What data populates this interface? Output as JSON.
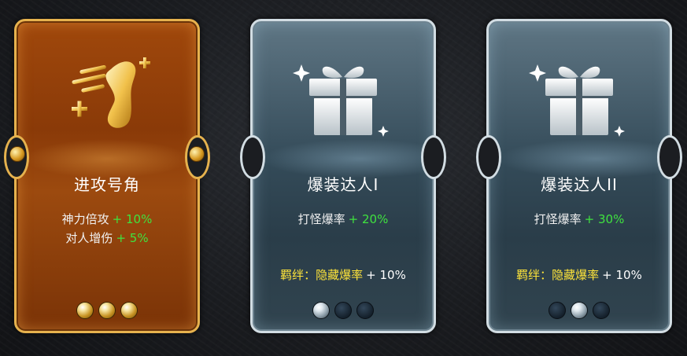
{
  "cards": [
    {
      "title": "进攻号角",
      "icon": "golden-foot-icon",
      "stats": [
        {
          "name": "神力倍攻",
          "value": "+ 10%"
        },
        {
          "name": "对人增伤",
          "value": "+ 5%"
        }
      ],
      "gems_active": 3,
      "gems_total": 3
    },
    {
      "title": "爆装达人I",
      "icon": "silver-gift-icon",
      "stats": [
        {
          "name": "打怪爆率",
          "value": "+ 20%"
        }
      ],
      "bond": {
        "label": "羁绊：隐藏爆率",
        "value": "+ 10%"
      },
      "gems_active": 1,
      "gems_total": 3
    },
    {
      "title": "爆装达人II",
      "icon": "silver-gift-icon",
      "stats": [
        {
          "name": "打怪爆率",
          "value": "+ 30%"
        }
      ],
      "bond": {
        "label": "羁绊：隐藏爆率",
        "value": "+ 10%"
      },
      "gems_active": 1,
      "gems_total": 3
    }
  ],
  "colors": {
    "gold_border": "#e6b24e",
    "silver_border": "#d2dde3",
    "stat_value_green": "#3fe23f",
    "bond_yellow": "#ffe53a"
  }
}
